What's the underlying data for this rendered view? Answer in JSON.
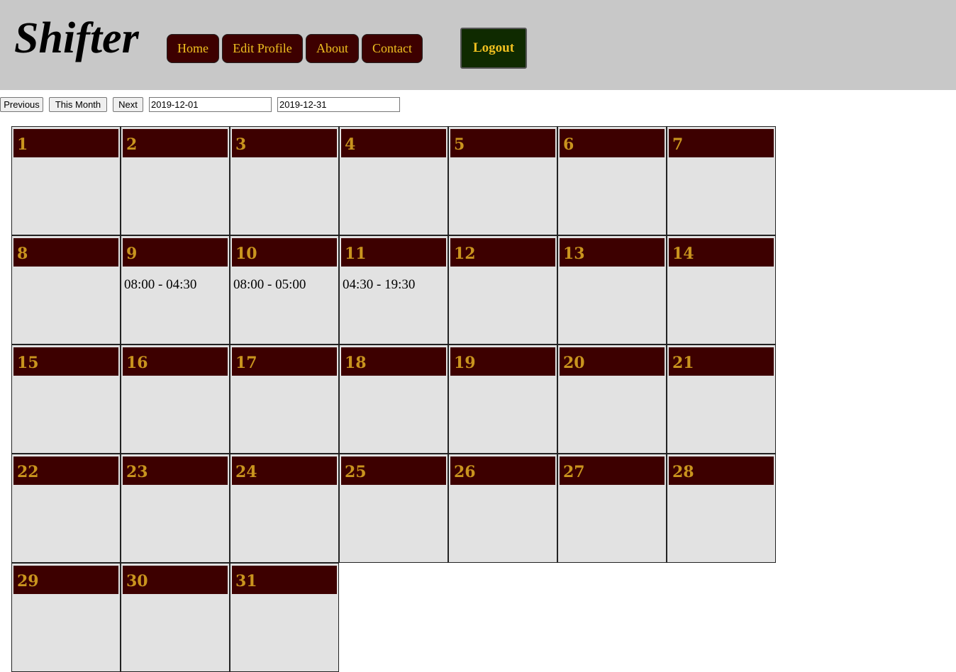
{
  "header": {
    "logo": "Shifter",
    "nav": [
      "Home",
      "Edit Profile",
      "About",
      "Contact"
    ],
    "logout": "Logout"
  },
  "controls": {
    "previous": "Previous",
    "this_month": "This Month",
    "next": "Next",
    "start_date": "2019-12-01",
    "end_date": "2019-12-31"
  },
  "colors": {
    "header_bg": "#c8c8c8",
    "nav_bg": "#3d0000",
    "nav_text": "#f0c020",
    "logout_bg": "#0f2a00",
    "day_header_bg": "#3d0000",
    "day_number": "#c9941e",
    "cell_bg": "#e2e2e2"
  },
  "calendar": {
    "days": [
      {
        "day": "1",
        "shift": ""
      },
      {
        "day": "2",
        "shift": ""
      },
      {
        "day": "3",
        "shift": ""
      },
      {
        "day": "4",
        "shift": ""
      },
      {
        "day": "5",
        "shift": ""
      },
      {
        "day": "6",
        "shift": ""
      },
      {
        "day": "7",
        "shift": ""
      },
      {
        "day": "8",
        "shift": ""
      },
      {
        "day": "9",
        "shift": "08:00 - 04:30"
      },
      {
        "day": "10",
        "shift": "08:00 - 05:00"
      },
      {
        "day": "11",
        "shift": "04:30 - 19:30"
      },
      {
        "day": "12",
        "shift": ""
      },
      {
        "day": "13",
        "shift": ""
      },
      {
        "day": "14",
        "shift": ""
      },
      {
        "day": "15",
        "shift": ""
      },
      {
        "day": "16",
        "shift": ""
      },
      {
        "day": "17",
        "shift": ""
      },
      {
        "day": "18",
        "shift": ""
      },
      {
        "day": "19",
        "shift": ""
      },
      {
        "day": "20",
        "shift": ""
      },
      {
        "day": "21",
        "shift": ""
      },
      {
        "day": "22",
        "shift": ""
      },
      {
        "day": "23",
        "shift": ""
      },
      {
        "day": "24",
        "shift": ""
      },
      {
        "day": "25",
        "shift": ""
      },
      {
        "day": "26",
        "shift": ""
      },
      {
        "day": "27",
        "shift": ""
      },
      {
        "day": "28",
        "shift": ""
      },
      {
        "day": "29",
        "shift": ""
      },
      {
        "day": "30",
        "shift": ""
      },
      {
        "day": "31",
        "shift": ""
      }
    ]
  }
}
